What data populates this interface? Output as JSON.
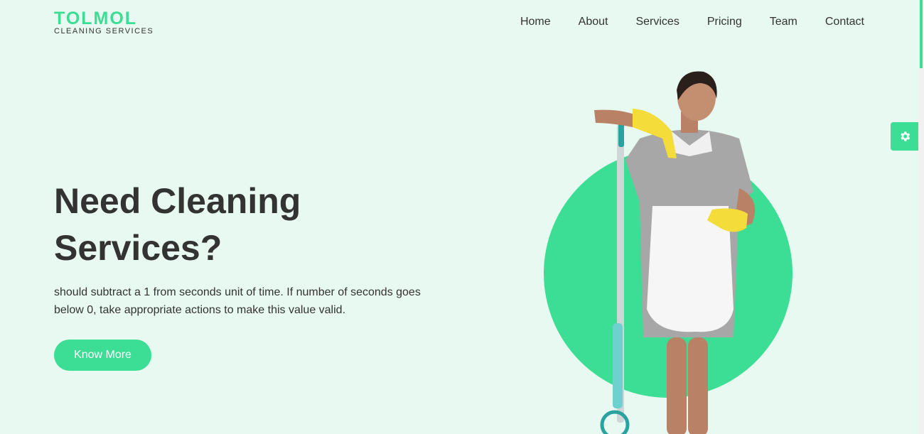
{
  "brand": {
    "name": "TOLMOL",
    "tagline": "CLEANING SERVICES",
    "accent": "#3cdd94",
    "background": "#e8f9f1"
  },
  "nav": {
    "items": [
      "Home",
      "About",
      "Services",
      "Pricing",
      "Team",
      "Contact"
    ]
  },
  "hero": {
    "title": "Need Cleaning Services?",
    "description": "should subtract a 1 from seconds unit of time. If number of seconds goes below 0, take appropriate actions to make this value valid.",
    "button_label": "Know More",
    "image": "cleaning-woman-with-mop"
  },
  "widgets": {
    "settings_icon": "gear-icon"
  }
}
